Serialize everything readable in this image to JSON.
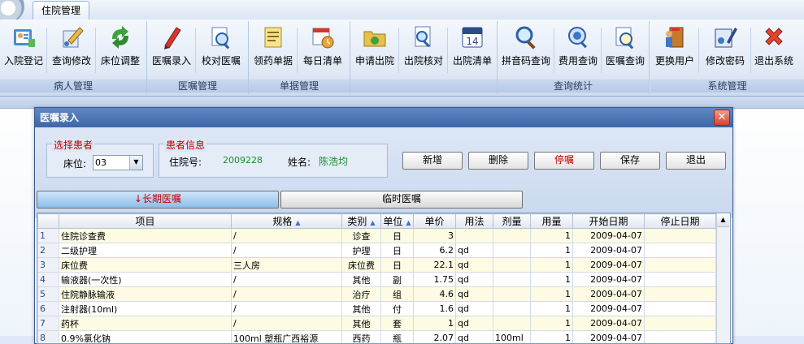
{
  "app": {
    "tab": "住院管理"
  },
  "ribbon": {
    "groups": [
      {
        "label": "病人管理",
        "buttons": [
          "入院登记",
          "查询修改",
          "床位调整"
        ]
      },
      {
        "label": "医嘱管理",
        "buttons": [
          "医嘱录入",
          "校对医嘱"
        ]
      },
      {
        "label": "单据管理",
        "buttons": [
          "领药单据",
          "每日清单"
        ]
      },
      {
        "label": "",
        "buttons": [
          "申请出院",
          "出院核对",
          "出院清单"
        ]
      },
      {
        "label": "查询统计",
        "buttons": [
          "拼音码查询",
          "费用查询",
          "医嘱查询"
        ]
      },
      {
        "label": "系统管理",
        "buttons": [
          "更换用户",
          "修改密码",
          "退出系统"
        ]
      }
    ]
  },
  "dialog": {
    "title": "医嘱录入",
    "close_glyph": "✕",
    "select_patient": {
      "legend": "选择患者",
      "bed_label": "床位:",
      "bed_value": "03"
    },
    "patient_info": {
      "legend": "患者信息",
      "id_label": "住院号:",
      "id_value": "2009228",
      "name_label": "姓名:",
      "name_value": "陈浩均"
    },
    "buttons": {
      "add": "新增",
      "delete": "删除",
      "stop": "停嘱",
      "save": "保存",
      "exit": "退出"
    },
    "tabs": {
      "long_term": "↓长期医嘱",
      "temporary": "临时医嘱"
    }
  },
  "grid": {
    "headers": [
      "",
      "项目",
      "规格",
      "类别",
      "单位",
      "单价",
      "用法",
      "剂量",
      "用量",
      "开始日期",
      "停止日期"
    ],
    "rows": [
      [
        "1",
        "住院诊查费",
        "/",
        "诊查",
        "日",
        "3",
        "",
        "",
        "1",
        "2009-04-07",
        ""
      ],
      [
        "2",
        "二级护理",
        "/",
        "护理",
        "日",
        "6.2",
        "qd",
        "",
        "1",
        "2009-04-07",
        ""
      ],
      [
        "3",
        "床位费",
        "三人房",
        "床位费",
        "日",
        "22.1",
        "qd",
        "",
        "1",
        "2009-04-07",
        ""
      ],
      [
        "4",
        "输液器(一次性)",
        "/",
        "其他",
        "副",
        "1.75",
        "qd",
        "",
        "1",
        "2009-04-07",
        ""
      ],
      [
        "5",
        "住院静脉输液",
        "/",
        "治疗",
        "组",
        "4.6",
        "qd",
        "",
        "1",
        "2009-04-07",
        ""
      ],
      [
        "6",
        "注射器(10ml)",
        "/",
        "其他",
        "付",
        "1.6",
        "qd",
        "",
        "1",
        "2009-04-07",
        ""
      ],
      [
        "7",
        "药杯",
        "/",
        "其他",
        "套",
        "1",
        "qd",
        "",
        "1",
        "2009-04-07",
        ""
      ],
      [
        "8",
        "0.9%氯化钠",
        "100ml 塑瓶广西裕源",
        "西药",
        "瓶",
        "2.07",
        "qd",
        "100ml",
        "1",
        "2009-04-07",
        ""
      ]
    ]
  },
  "colors": {
    "accent_red": "#c00000",
    "title_blue": "#3d67a8",
    "id_green": "#1f8a2f"
  }
}
